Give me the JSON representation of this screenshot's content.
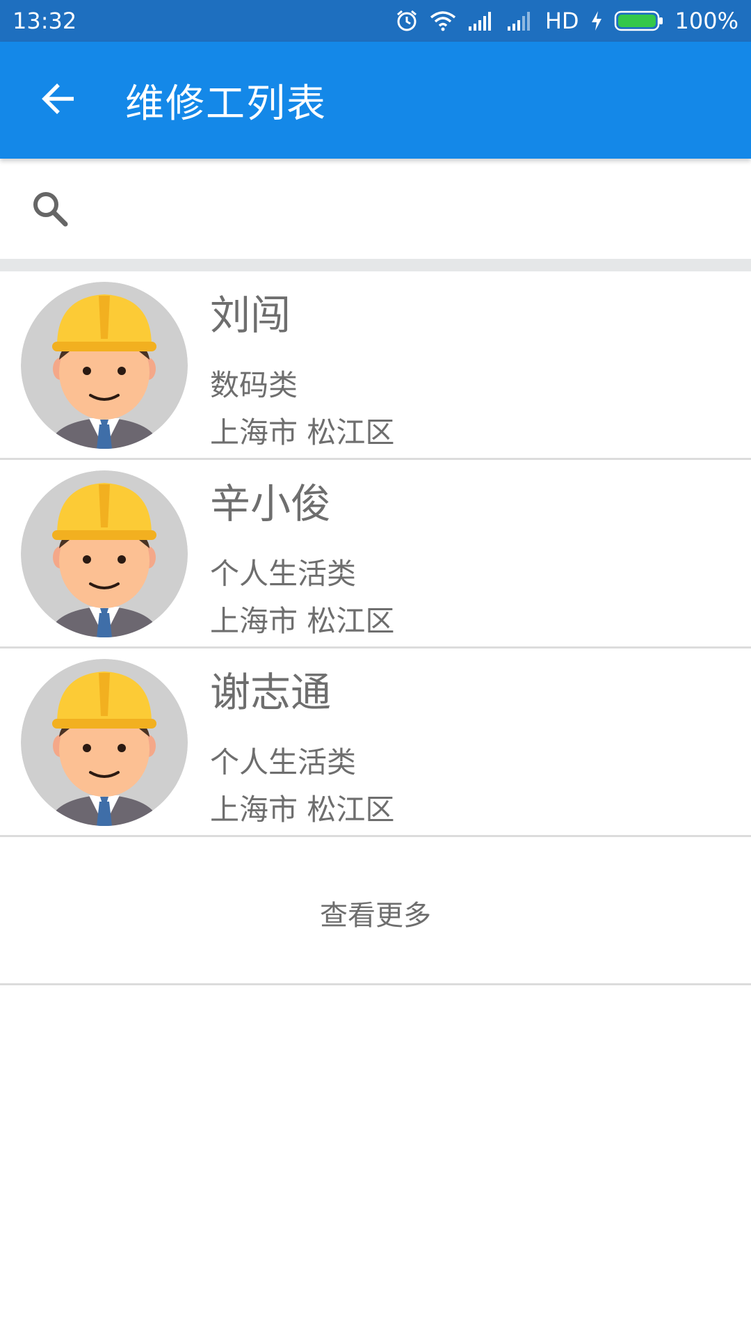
{
  "status_bar": {
    "time": "13:32",
    "network_label": "HD",
    "battery": "100%",
    "icons": [
      "alarm-icon",
      "wifi-icon",
      "signal-icon",
      "signal-icon",
      "charging-icon",
      "battery-icon"
    ]
  },
  "app_bar": {
    "title": "维修工列表",
    "back_icon": "arrow-left-icon",
    "color": "#1488e8"
  },
  "search": {
    "placeholder": "",
    "value": "",
    "icon": "search-icon"
  },
  "workers": [
    {
      "name": "刘闯",
      "category": "数码类",
      "location": "上海市 松江区"
    },
    {
      "name": "辛小俊",
      "category": "个人生活类",
      "location": "上海市 松江区"
    },
    {
      "name": "谢志通",
      "category": "个人生活类",
      "location": "上海市 松江区"
    }
  ],
  "more": {
    "label": "查看更多"
  }
}
